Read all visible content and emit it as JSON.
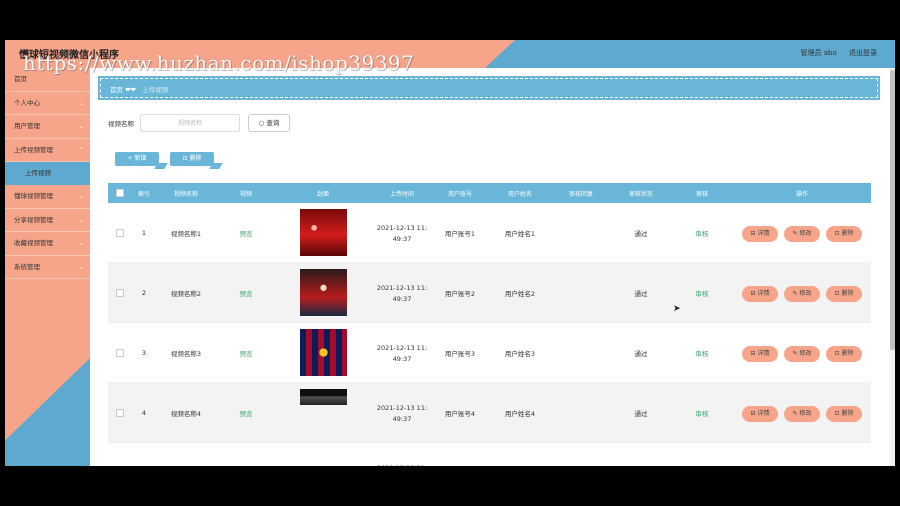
{
  "header": {
    "app_title": "懂球短视频微信小程序",
    "admin_label": "管理员 abo",
    "logout_label": "退出登录"
  },
  "watermark": "https://www.huzhan.com/ishop39397",
  "sidebar": {
    "items": [
      {
        "label": "首页"
      },
      {
        "label": "个人中心"
      },
      {
        "label": "用户管理"
      },
      {
        "label": "上传视频管理"
      },
      {
        "label": "上传视频"
      },
      {
        "label": "懂球视频管理"
      },
      {
        "label": "分享视频管理"
      },
      {
        "label": "收藏视频管理"
      },
      {
        "label": "系统管理"
      }
    ]
  },
  "breadcrumb": {
    "home": "首页",
    "current": "上传视频"
  },
  "search": {
    "label": "视频名称",
    "placeholder": "视频名称",
    "button": "查询"
  },
  "actions": {
    "add": "新增",
    "delete": "删除"
  },
  "table": {
    "columns": [
      "索引",
      "视频名称",
      "视频",
      "封面",
      "上传时间",
      "用户账号",
      "用户姓名",
      "审核回复",
      "审核状态",
      "审核",
      "操作"
    ],
    "rows": [
      {
        "index": "1",
        "name": "视频名称1",
        "video": "预览",
        "time_a": "2021-12-13 11:",
        "time_b": "49:37",
        "account": "用户账号1",
        "username": "用户姓名1",
        "status": "通过",
        "audit": "审核"
      },
      {
        "index": "2",
        "name": "视频名称2",
        "video": "预览",
        "time_a": "2021-12-13 11:",
        "time_b": "49:37",
        "account": "用户账号2",
        "username": "用户姓名2",
        "status": "通过",
        "audit": "审核"
      },
      {
        "index": "3",
        "name": "视频名称3",
        "video": "预览",
        "time_a": "2021-12-13 11:",
        "time_b": "49:37",
        "account": "用户账号3",
        "username": "用户姓名3",
        "status": "通过",
        "audit": "审核"
      },
      {
        "index": "4",
        "name": "视频名称4",
        "video": "预览",
        "time_a": "2021-12-13 11:",
        "time_b": "49:37",
        "account": "用户账号4",
        "username": "用户姓名4",
        "status": "通过",
        "audit": "审核"
      },
      {
        "index": "",
        "name": "",
        "video": "",
        "time_a": "2021-12-13 11:",
        "time_b": "",
        "account": "",
        "username": "",
        "status": "",
        "audit": ""
      }
    ],
    "ops": {
      "detail": "详情",
      "edit": "修改",
      "delete": "删除"
    }
  },
  "colors": {
    "accent_blue": "#6ab6d8",
    "accent_salmon": "#f7a58a",
    "ok_green": "#3aa76d"
  }
}
